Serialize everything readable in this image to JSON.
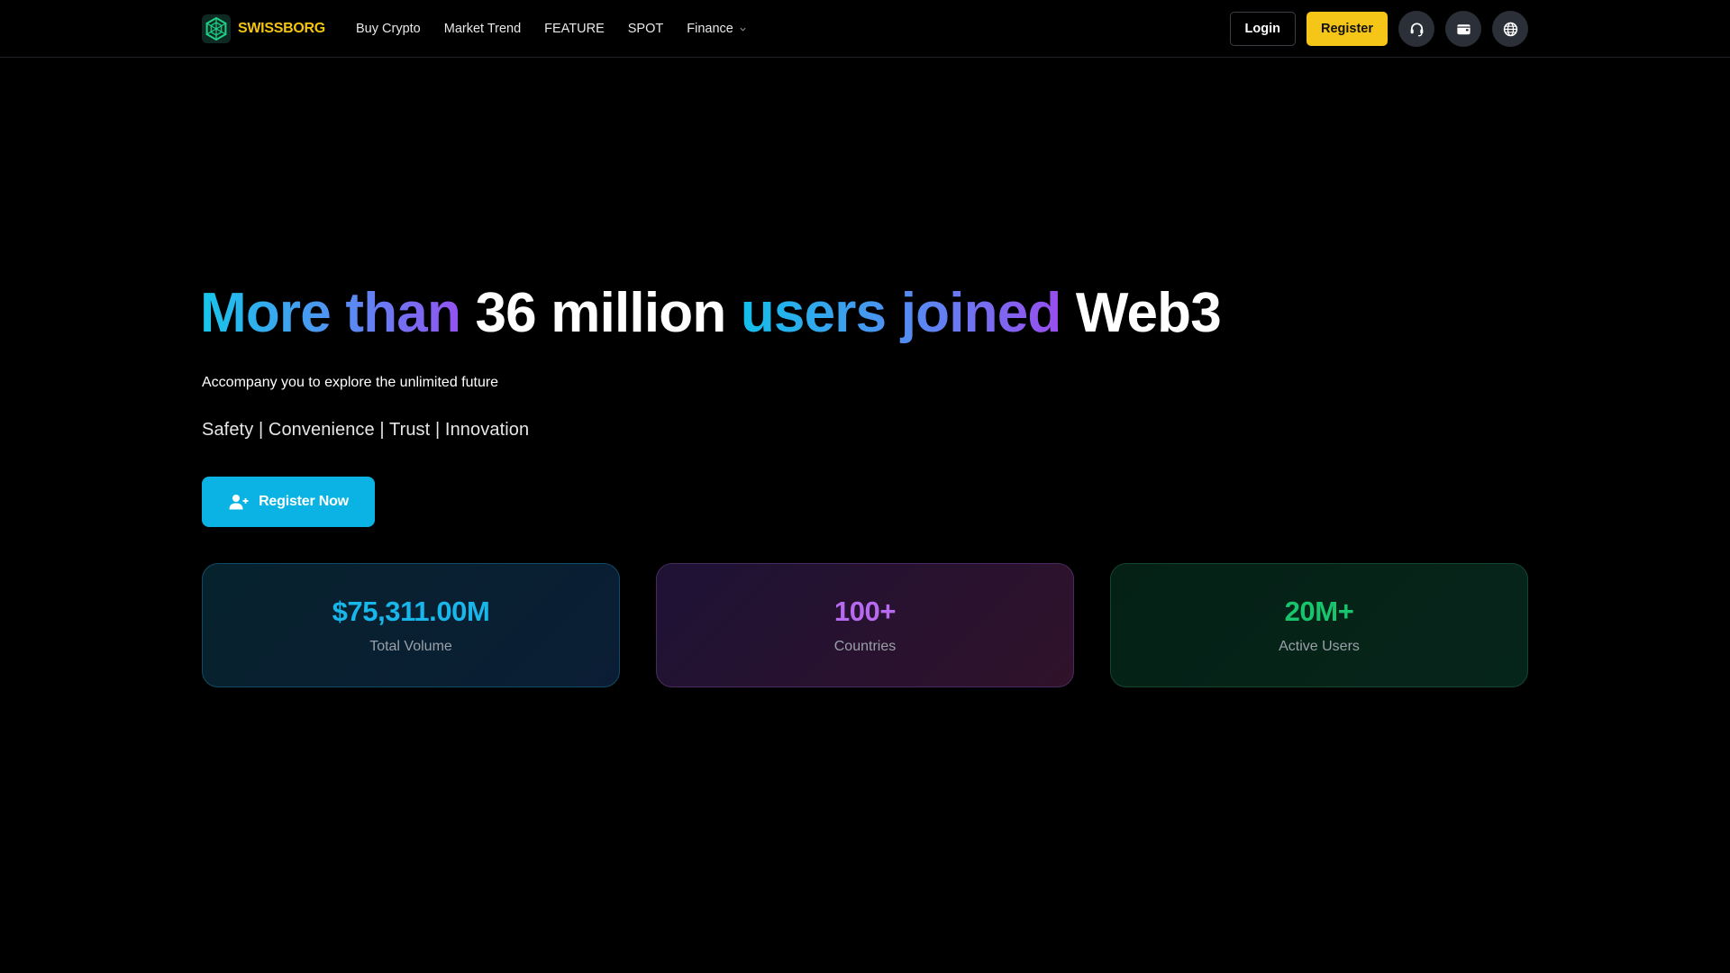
{
  "header": {
    "brand_name": "SWISSBORG",
    "nav": [
      {
        "label": "Buy Crypto"
      },
      {
        "label": "Market Trend"
      },
      {
        "label": "FEATURE"
      },
      {
        "label": "SPOT"
      },
      {
        "label": "Finance",
        "has_dropdown": true
      }
    ],
    "login_label": "Login",
    "register_label": "Register",
    "icons": [
      "headset-icon",
      "wallet-icon",
      "globe-icon"
    ]
  },
  "hero": {
    "title_parts": [
      {
        "text": "More than ",
        "style": "gradient"
      },
      {
        "text": "36 million ",
        "style": "white"
      },
      {
        "text": "users joined ",
        "style": "gradient"
      },
      {
        "text": "Web3",
        "style": "white"
      }
    ],
    "subtitle": "Accompany you to explore the unlimited future",
    "values_line": "Safety | Convenience | Trust | Innovation",
    "cta_label": "Register Now"
  },
  "stats": [
    {
      "value": "$75,311.00M",
      "label": "Total Volume",
      "color": "#18b6ea"
    },
    {
      "value": "100+",
      "label": "Countries",
      "color": "#b76af0"
    },
    {
      "value": "20M+",
      "label": "Active Users",
      "color": "#18c46c"
    }
  ],
  "colors": {
    "background": "#000000",
    "brand": "#f3c50f",
    "register_button": "#f5c518",
    "cta_button": "#0ab3e3",
    "gradient_start": "#16c6ea",
    "gradient_end": "#9b4bf0"
  }
}
